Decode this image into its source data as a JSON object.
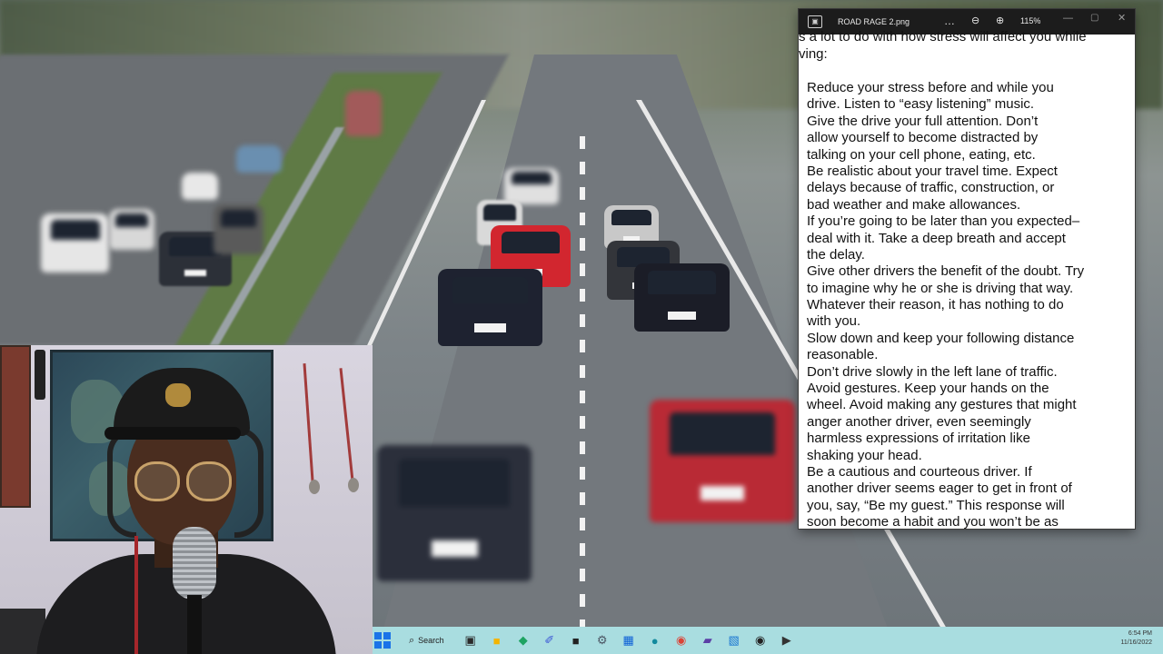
{
  "viewer": {
    "title": "ROAD RAGE 2.png",
    "more": "…",
    "zoom_out_icon": "⊖",
    "zoom_in_icon": "⊕",
    "zoom": "115%",
    "minimize": "—",
    "maximize": "▢",
    "close": "✕",
    "intro_line1": "s a lot to do with how stress will affect you while",
    "intro_line2": "ving:",
    "lines": [
      "Reduce your stress before and while you",
      "drive. Listen to “easy listening” music.",
      "Give the drive your full attention. Don’t",
      "allow yourself to become distracted by",
      "talking on your cell phone, eating, etc.",
      "Be realistic about your travel time. Expect",
      "delays because of traffic, construction, or",
      "bad weather and make allowances.",
      "If you’re going to be later than you expected–",
      "deal with it. Take a deep breath and accept",
      "the delay.",
      "Give other drivers the benefit of the doubt. Try",
      "to imagine why he or she is driving that way.",
      "Whatever their reason, it has nothing to do",
      "with you.",
      "Slow down and keep your following distance",
      "reasonable.",
      "Don’t drive slowly in the left lane of traffic.",
      "Avoid gestures. Keep your hands on the",
      "wheel. Avoid making any gestures that might",
      "anger another driver, even seemingly",
      "harmless expressions of irritation like",
      "shaking your head.",
      "Be a cautious and courteous driver. If",
      "another driver seems eager to get in front of",
      "you, say, “Be my guest.” This response will",
      "soon become a habit and you won’t be as"
    ]
  },
  "taskbar": {
    "search_label": "Search",
    "search_icon": "⌕",
    "apps": [
      {
        "name": "task-view-icon",
        "glyph": "▣",
        "color": "#2a2a2a"
      },
      {
        "name": "file-explorer-icon",
        "glyph": "■",
        "color": "#f4b400"
      },
      {
        "name": "store-icon",
        "glyph": "◆",
        "color": "#1ea362"
      },
      {
        "name": "editor-icon",
        "glyph": "✐",
        "color": "#3b55d6"
      },
      {
        "name": "notes-icon",
        "glyph": "■",
        "color": "#222222"
      },
      {
        "name": "settings-icon",
        "glyph": "⚙",
        "color": "#4b5563"
      },
      {
        "name": "calendar-icon",
        "glyph": "▦",
        "color": "#0b5ed7"
      },
      {
        "name": "edge-icon",
        "glyph": "●",
        "color": "#138a9e"
      },
      {
        "name": "chrome-icon",
        "glyph": "◉",
        "color": "#db4437"
      },
      {
        "name": "video-editor-icon",
        "glyph": "▰",
        "color": "#5b3fa6"
      },
      {
        "name": "photos-icon",
        "glyph": "▧",
        "color": "#1976d2"
      },
      {
        "name": "obs-icon",
        "glyph": "◉",
        "color": "#222222"
      },
      {
        "name": "media-player-icon",
        "glyph": "▶",
        "color": "#333333"
      }
    ],
    "time": "6:54 PM",
    "date": "11/16/2022"
  }
}
